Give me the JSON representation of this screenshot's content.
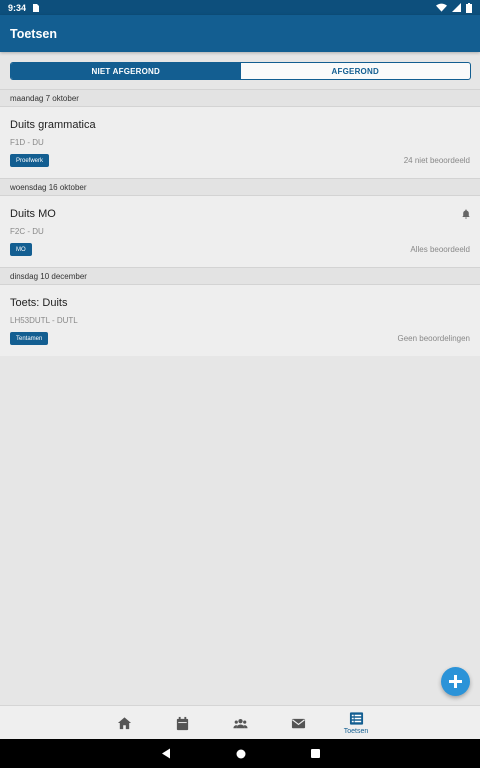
{
  "status_bar": {
    "time": "9:34"
  },
  "app_bar": {
    "title": "Toetsen"
  },
  "segmented": {
    "not_done": "NIET AFGEROND",
    "done": "AFGEROND",
    "active": "not_done"
  },
  "groups": [
    {
      "date": "maandag 7 oktober",
      "title": "Duits grammatica",
      "code": "F1D - DU",
      "badge": "Proefwerk",
      "status": "24 niet beoordeeld",
      "has_bell": false
    },
    {
      "date": "woensdag 16 oktober",
      "title": "Duits MO",
      "code": "F2C - DU",
      "badge": "MO",
      "status": "Alles beoordeeld",
      "has_bell": true
    },
    {
      "date": "dinsdag 10 december",
      "title": "Toets: Duits",
      "code": "LH53DUTL - DUTL",
      "badge": "Tentamen",
      "status": "Geen beoordelingen",
      "has_bell": false
    }
  ],
  "bottom_nav": [
    {
      "icon": "home-icon",
      "label": ""
    },
    {
      "icon": "calendar-icon",
      "label": ""
    },
    {
      "icon": "people-icon",
      "label": ""
    },
    {
      "icon": "mail-icon",
      "label": ""
    },
    {
      "icon": "list-icon",
      "label": "Toetsen",
      "active": true
    }
  ],
  "colors": {
    "primary": "#135e91",
    "status_bar": "#0d4f7c",
    "fab": "#2b93d8",
    "inactive_icon": "#555555"
  }
}
